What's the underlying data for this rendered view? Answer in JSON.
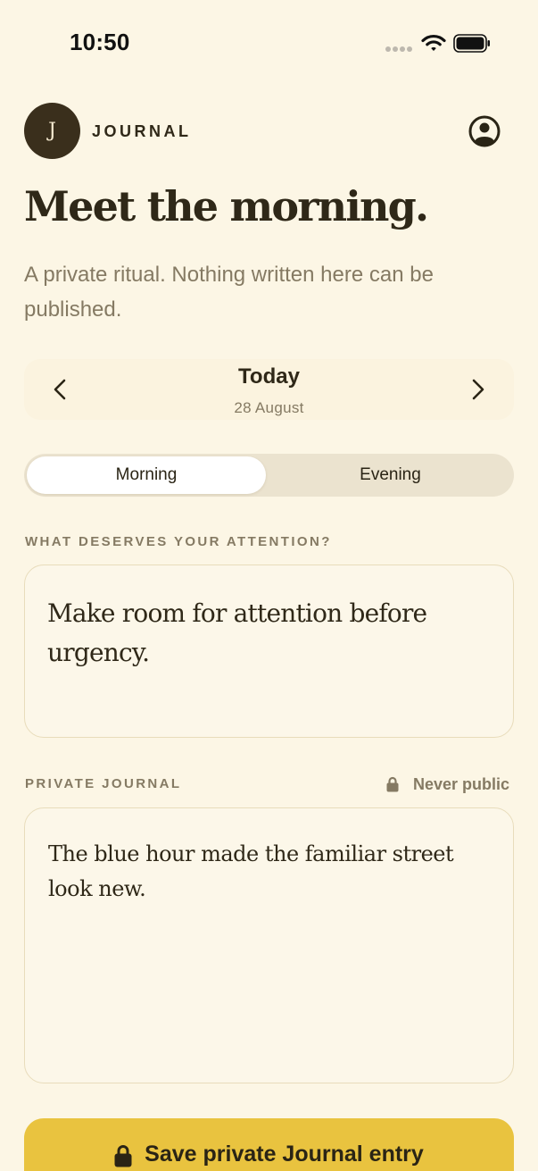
{
  "status_bar": {
    "time": "10:50",
    "icons": [
      "signal-dots-icon",
      "wifi-icon",
      "battery-icon"
    ]
  },
  "header": {
    "avatar_initial": "J",
    "brand": "JOURNAL",
    "profile_icon": "user-circle-icon"
  },
  "hero": {
    "title": "Meet the morning.",
    "subtitle": "A private ritual. Nothing written here can be published."
  },
  "date_nav": {
    "label": "Today",
    "date": "28 August",
    "prev_icon": "chevron-left-icon",
    "next_icon": "chevron-right-icon"
  },
  "segments": {
    "items": [
      "Morning",
      "Evening"
    ],
    "selected": "Morning"
  },
  "attention": {
    "label": "WHAT DESERVES YOUR ATTENTION?",
    "value": "Make room for attention before urgency."
  },
  "journal": {
    "label": "PRIVATE JOURNAL",
    "privacy_badge": "Never public",
    "value": "The blue hour made the familiar street look new."
  },
  "save": {
    "label": "Save private Journal entry",
    "icon": "lock-icon"
  },
  "colors": {
    "background": "#fcf6e5",
    "ink": "#2f2818",
    "muted": "#857a63",
    "accent": "#e9c33f",
    "avatar": "#3a2f1c"
  }
}
